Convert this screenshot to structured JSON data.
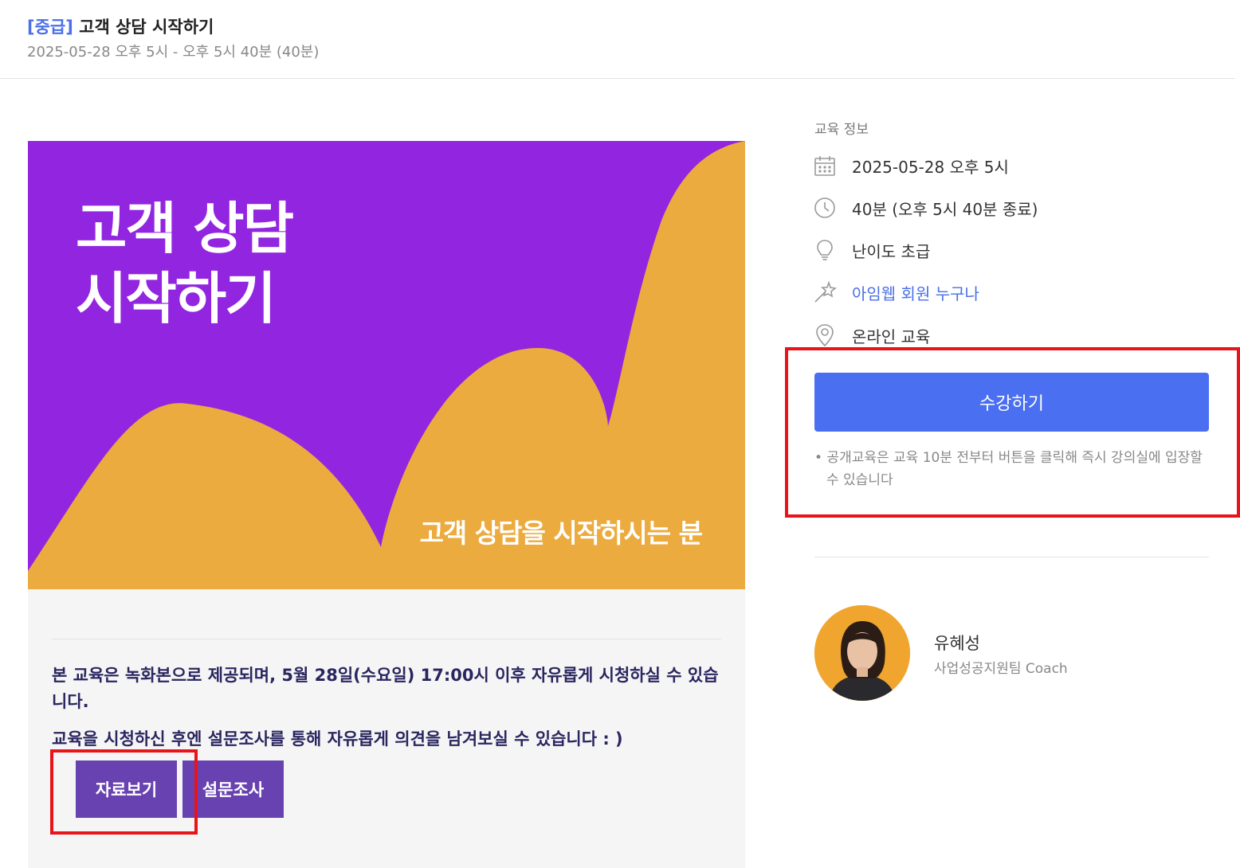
{
  "header": {
    "level": "[중급]",
    "title": "고객 상담 시작하기",
    "schedule": "2025-05-28 오후 5시 - 오후 5시 40분 (40분)"
  },
  "banner": {
    "title": "고객 상담\n시작하기",
    "subtitle": "고객 상담을 시작하시는 분",
    "colors": {
      "background": "#9226e0",
      "shape": "#ecab3e"
    }
  },
  "content": {
    "notice": "본 교육은 녹화본으로 제공되며, 5월 28일(수요일) 17:00시 이후 자유롭게 시청하실 수 있습니다.",
    "survey_notice": "교육을 시청하신 후엔 설문조사를 통해 자유롭게 의견을 남겨보실 수 있습니다 : )",
    "material_button": "자료보기",
    "survey_button": "설문조사"
  },
  "info": {
    "label": "교육 정보",
    "items": [
      {
        "icon": "calendar-icon",
        "text": "2025-05-28 오후 5시"
      },
      {
        "icon": "clock-icon",
        "text": "40분 (오후 5시 40분 종료)"
      },
      {
        "icon": "lightbulb-icon",
        "text": "난이도 초급"
      },
      {
        "icon": "magic-wand-icon",
        "text": "아임웹 회원 누구나"
      },
      {
        "icon": "location-pin-icon",
        "text": "온라인 교육"
      }
    ],
    "enroll_button": "수강하기",
    "enroll_note": "• 공개교육은 교육 10분 전부터 버튼을 클릭해 즉시 강의실에 입장할 수 있습니다"
  },
  "coach": {
    "name": "유혜성",
    "role": "사업성공지원팀 Coach"
  },
  "colors": {
    "accent": "#4a6ff1",
    "link": "#4a6fe8",
    "action_button": "#6842b0",
    "highlight": "#e8141a"
  }
}
